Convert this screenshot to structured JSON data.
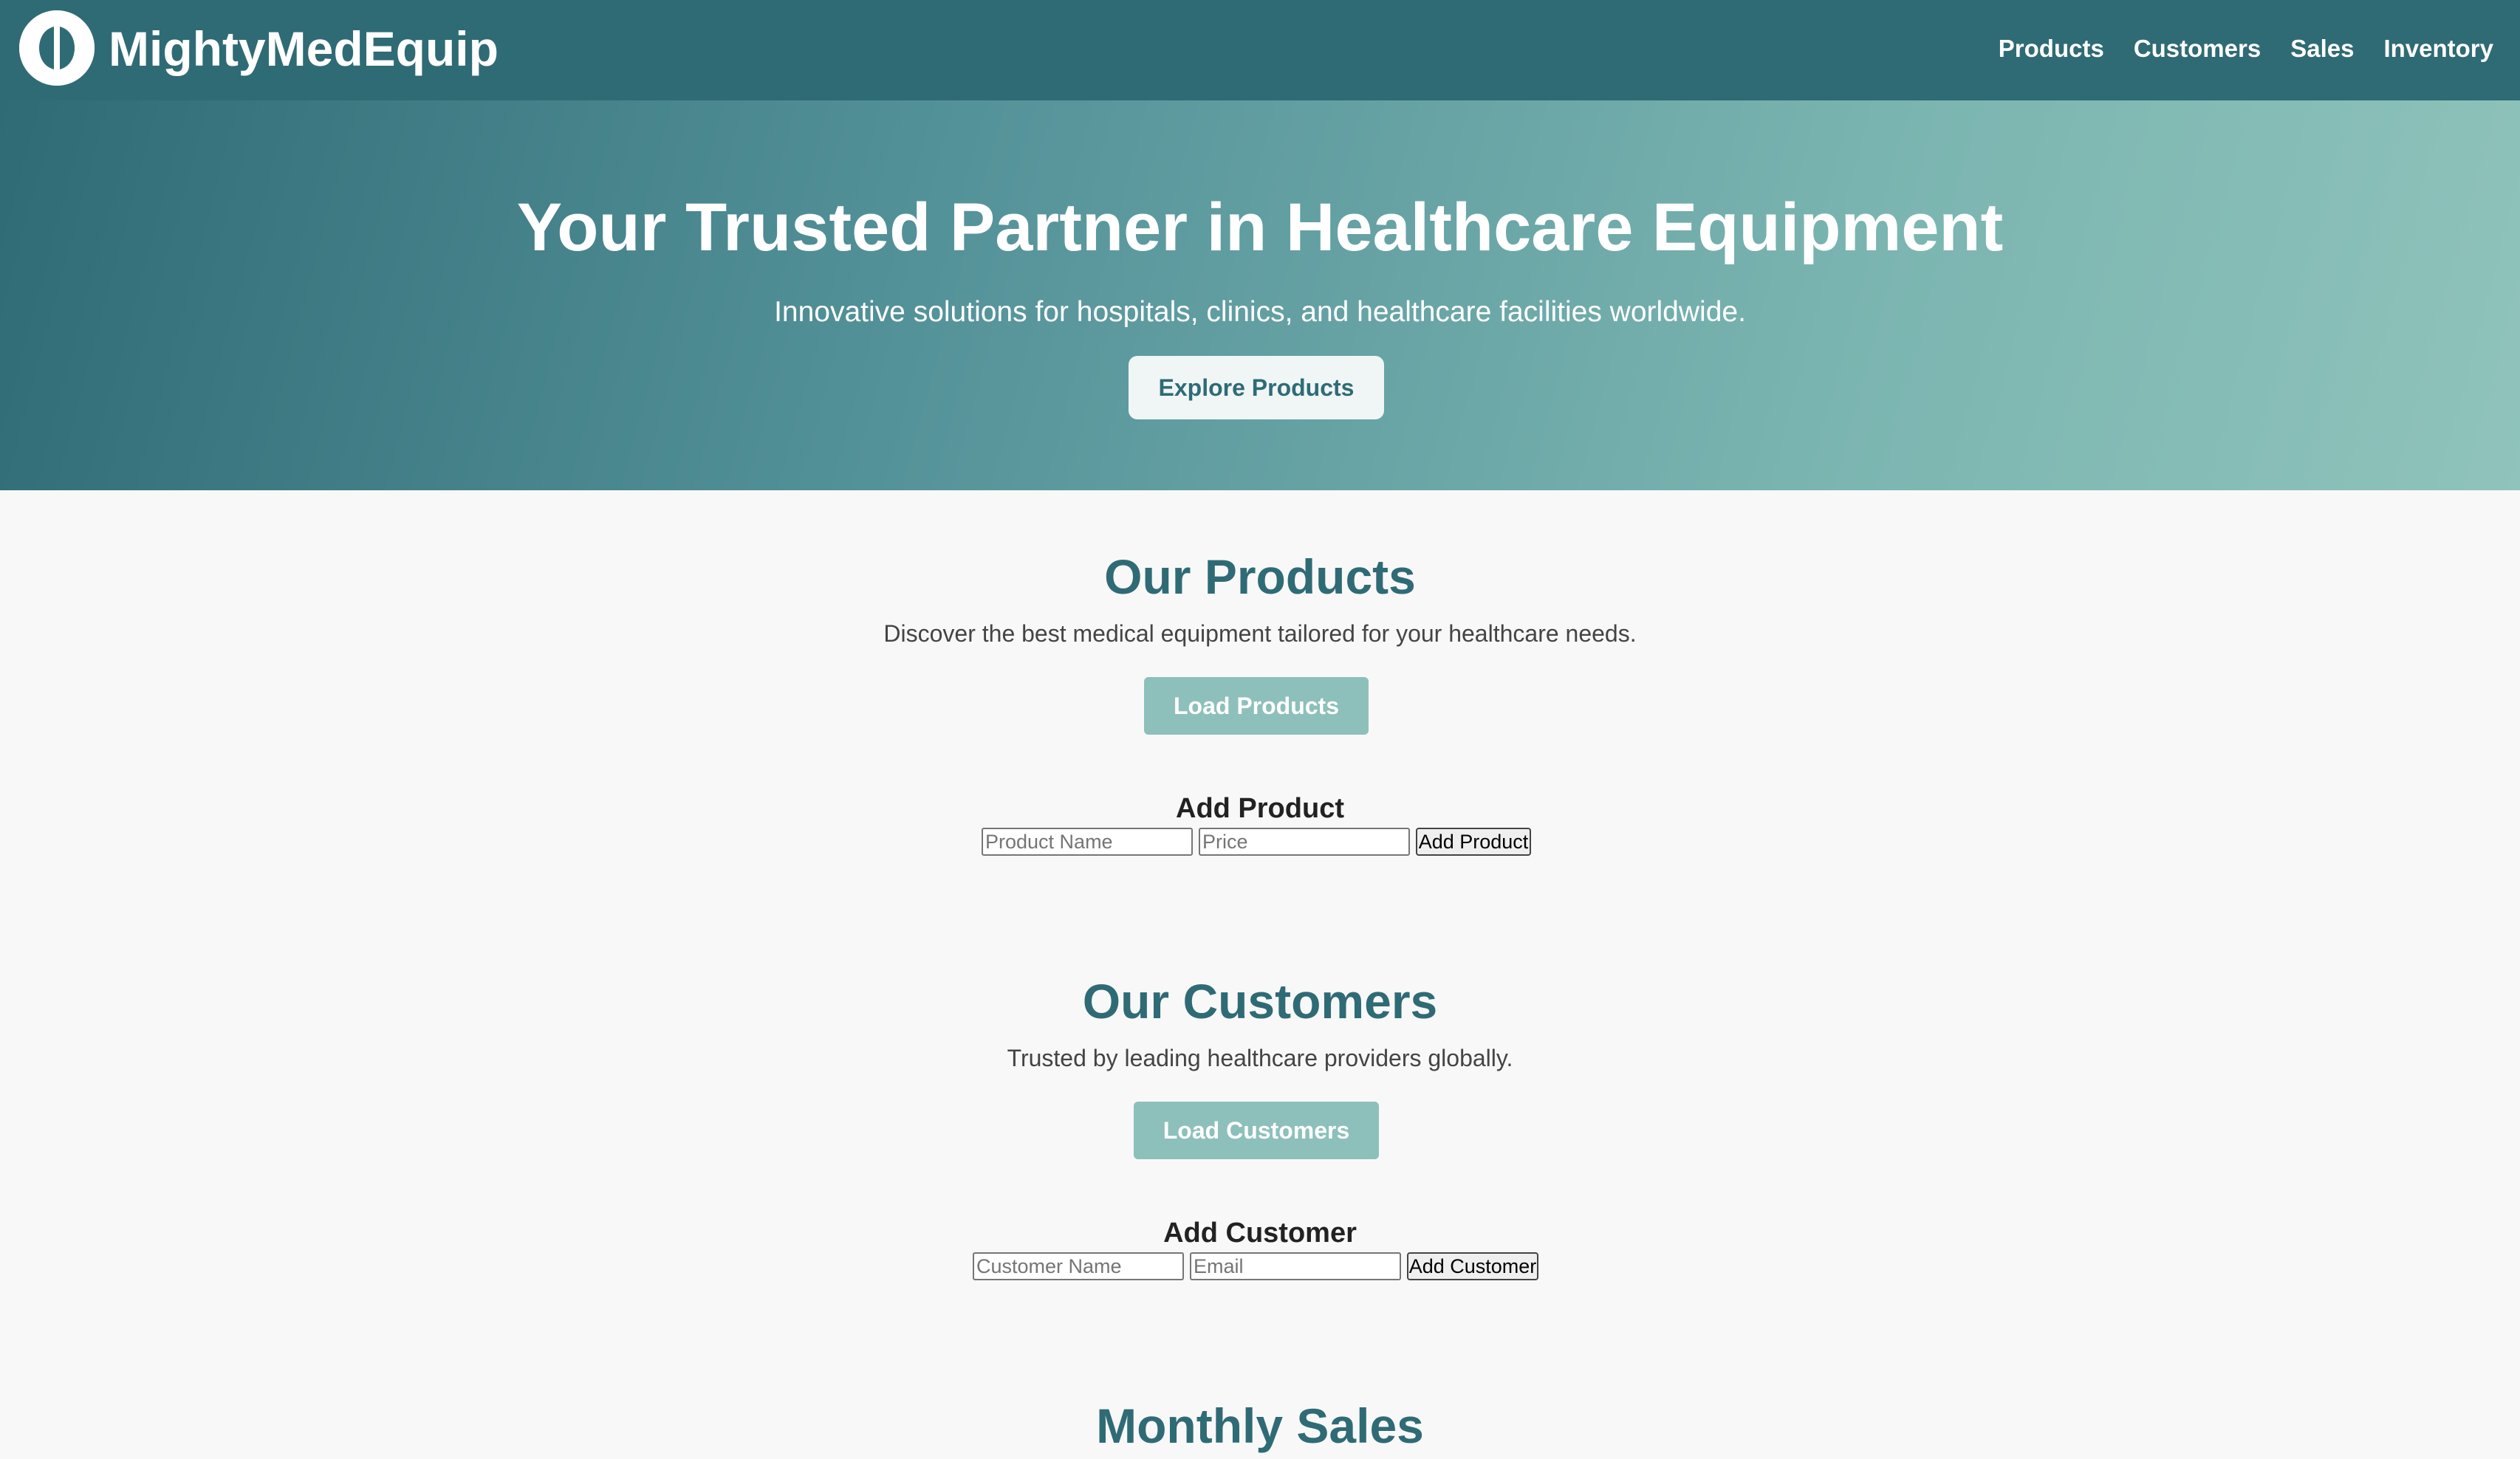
{
  "brand": {
    "name": "MightyMedEquip",
    "logo_icon": "split-circle-logo-icon"
  },
  "nav": {
    "items": [
      "Products",
      "Customers",
      "Sales",
      "Inventory"
    ]
  },
  "hero": {
    "title": "Your Trusted Partner in Healthcare Equipment",
    "subtitle": "Innovative solutions for hospitals, clinics, and healthcare facilities worldwide.",
    "cta_label": "Explore Products"
  },
  "products": {
    "title": "Our Products",
    "description": "Discover the best medical equipment tailored for your healthcare needs.",
    "load_label": "Load Products",
    "form": {
      "title": "Add Product",
      "name_placeholder": "Product Name",
      "price_placeholder": "Price",
      "submit_label": "Add Product"
    }
  },
  "customers": {
    "title": "Our Customers",
    "description": "Trusted by leading healthcare providers globally.",
    "load_label": "Load Customers",
    "form": {
      "title": "Add Customer",
      "name_placeholder": "Customer Name",
      "email_placeholder": "Email",
      "submit_label": "Add Customer"
    }
  },
  "sales": {
    "title": "Monthly Sales"
  },
  "colors": {
    "primary": "#2f6b75",
    "accent_light": "#8dc0bb",
    "page_background": "#f8f8f8"
  }
}
